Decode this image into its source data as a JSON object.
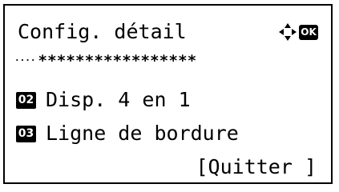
{
  "screen": {
    "title": "Config. détail",
    "nav_icon": "four-way-arrow-icon",
    "ok_key": "OK",
    "stars_lead": "····",
    "stars": "*****************",
    "items": [
      {
        "number": "02",
        "label": "Disp. 4 en 1"
      },
      {
        "number": "03",
        "label": "Ligne de bordure"
      }
    ],
    "soft_key": "[Quitter ]"
  },
  "colors": {
    "background": "#ffffff",
    "foreground": "#000000"
  }
}
